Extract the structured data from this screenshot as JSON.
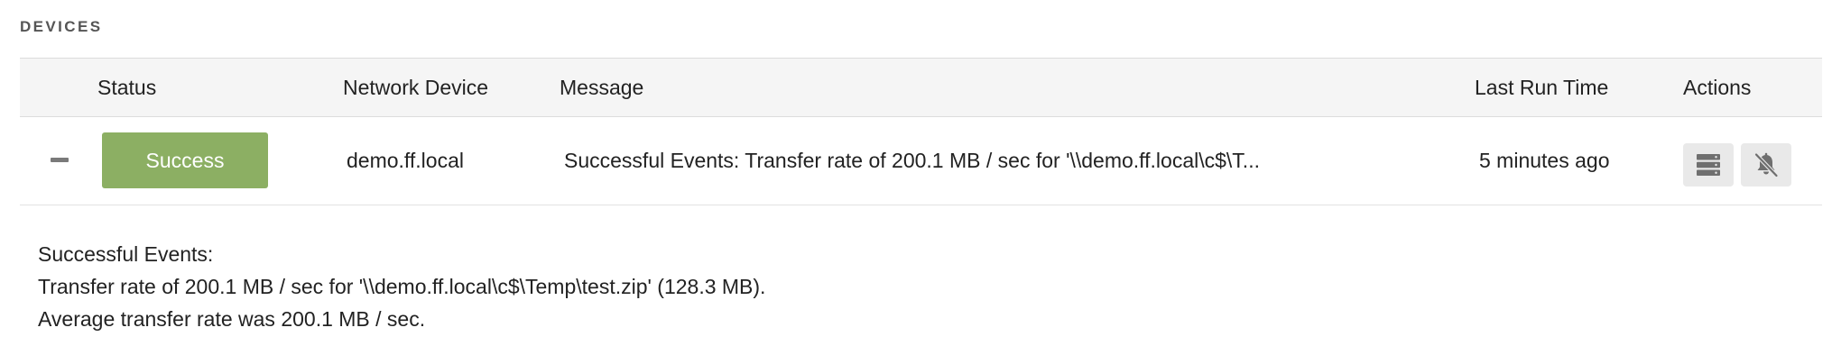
{
  "section": {
    "title": "DEVICES"
  },
  "table": {
    "columns": {
      "status": "Status",
      "network_device": "Network Device",
      "message": "Message",
      "last_run_time": "Last Run Time",
      "actions": "Actions"
    },
    "rows": [
      {
        "expanded": true,
        "status": "Success",
        "status_color": "#8caf63",
        "network_device": "demo.ff.local",
        "message": "Successful Events: Transfer rate of 200.1 MB / sec for '\\\\demo.ff.local\\c$\\T...",
        "last_run_time": "5 minutes ago",
        "actions": [
          {
            "icon": "server-icon"
          },
          {
            "icon": "bell-off-icon"
          }
        ],
        "details": [
          "Successful Events:",
          "Transfer rate of 200.1 MB / sec for '\\\\demo.ff.local\\c$\\Temp\\test.zip' (128.3 MB).",
          "Average transfer rate was 200.1 MB / sec."
        ]
      }
    ]
  }
}
